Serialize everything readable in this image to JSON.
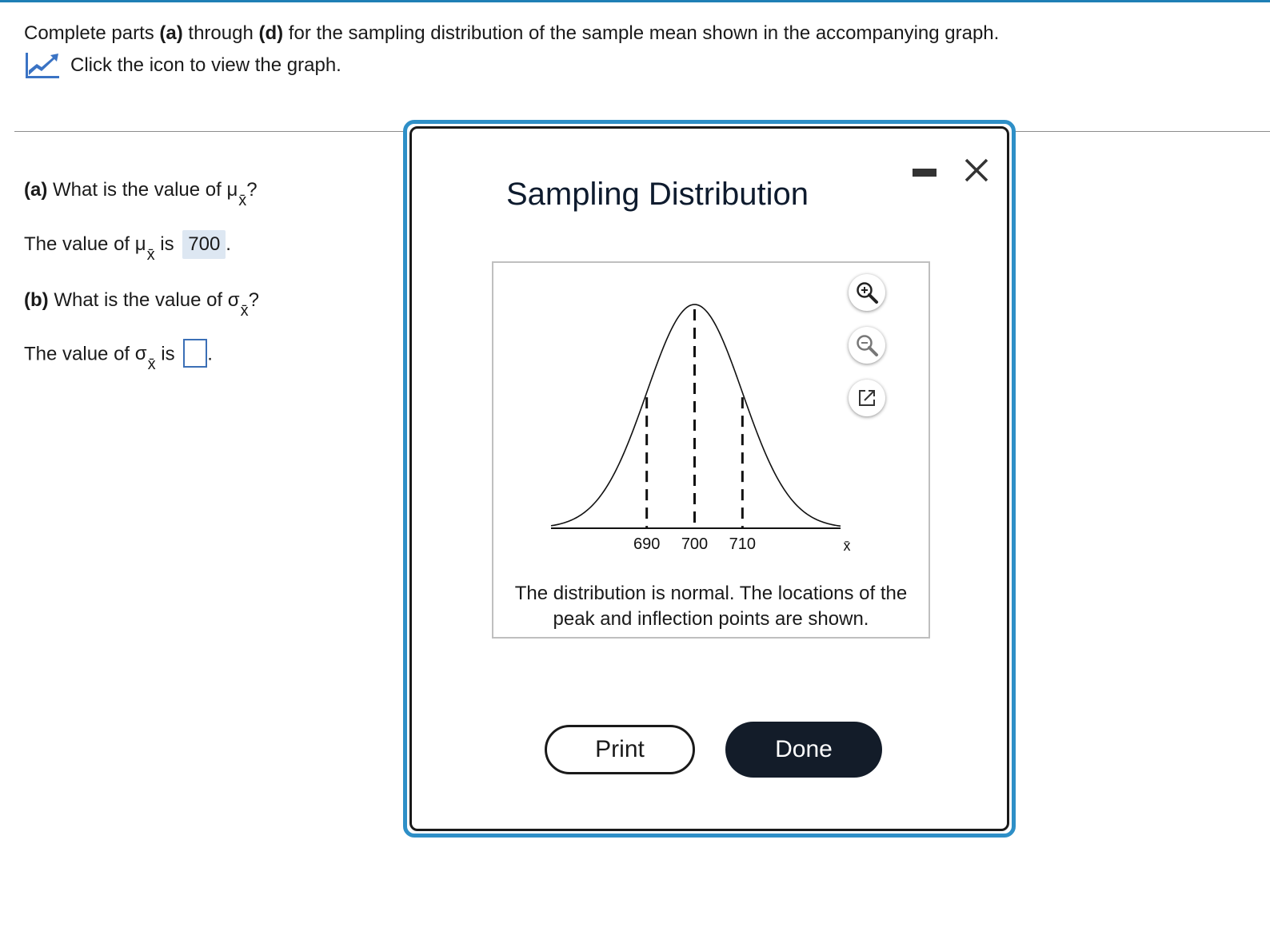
{
  "instructions": {
    "prefix": "Complete parts ",
    "part_a": "(a)",
    "through": " through ",
    "part_d": "(d)",
    "suffix": " for the sampling distribution of the sample mean shown in the accompanying graph."
  },
  "graph_link": {
    "icon": "chart-icon",
    "label": "Click the icon to view the graph."
  },
  "questions": {
    "a": {
      "label": "(a)",
      "prompt": " What is the value of ",
      "symbol": "μ",
      "subscript": "x̄",
      "end": "?",
      "answer_prefix": "The value of ",
      "answer_mid": " is ",
      "answer_value": "700",
      "answer_end": "."
    },
    "b": {
      "label": "(b)",
      "prompt": " What is the value of ",
      "symbol": "σ",
      "subscript": "x̄",
      "end": "?",
      "answer_prefix": "The value of ",
      "answer_mid": " is ",
      "answer_value": "",
      "answer_end": "."
    }
  },
  "modal": {
    "title": "Sampling Distribution",
    "caption_line1": "The distribution is normal. The locations of the",
    "caption_line2": "peak and inflection points are shown.",
    "print_label": "Print",
    "done_label": "Done",
    "tools": [
      "zoom-in-icon",
      "zoom-out-icon",
      "popout-icon"
    ]
  },
  "chart_data": {
    "type": "line",
    "distribution": "normal",
    "mean": 700,
    "sd": 10,
    "marked_x": [
      690,
      700,
      710
    ],
    "tick_labels": [
      "690",
      "700",
      "710"
    ],
    "xlabel": "x̄",
    "ylabel": "",
    "grid": false
  },
  "colors": {
    "accent": "#2e8fc7",
    "link_icon": "#3a73c4",
    "answer_bg": "#dde7f2",
    "done_bg": "#131c29"
  }
}
